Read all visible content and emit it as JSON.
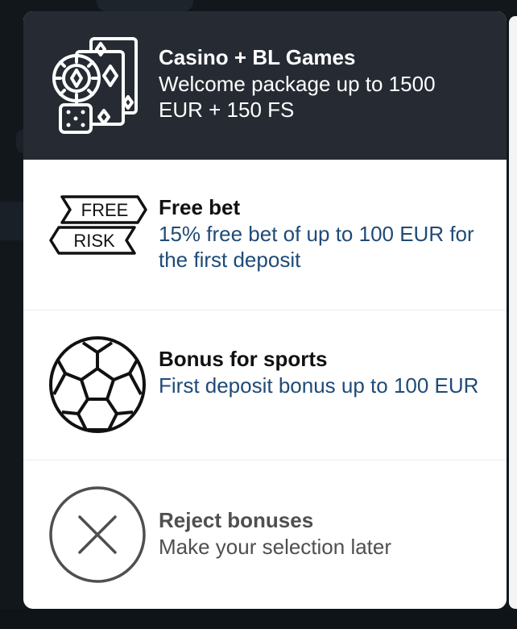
{
  "options": [
    {
      "title": "Casino + BL Games",
      "description": "Welcome package up to 1500 EUR + 150 FS",
      "icon": "cards-chip-dice-icon"
    },
    {
      "title": "Free bet",
      "description": "15% free bet of up to 100 EUR for the first deposit",
      "icon": "free-risk-ribbons-icon",
      "icon_text_top": "FREE",
      "icon_text_bottom": "RISK"
    },
    {
      "title": "Bonus for sports",
      "description": "First deposit bonus up to 100 EUR",
      "icon": "soccer-ball-icon"
    },
    {
      "title": "Reject bonuses",
      "description": "Make your selection later",
      "icon": "close-circle-icon"
    }
  ],
  "colors": {
    "selected_bg": "#262b33",
    "sheet_bg": "#ffffff",
    "desc_blue": "#1f4b77",
    "muted_text": "#4f4f4f"
  }
}
